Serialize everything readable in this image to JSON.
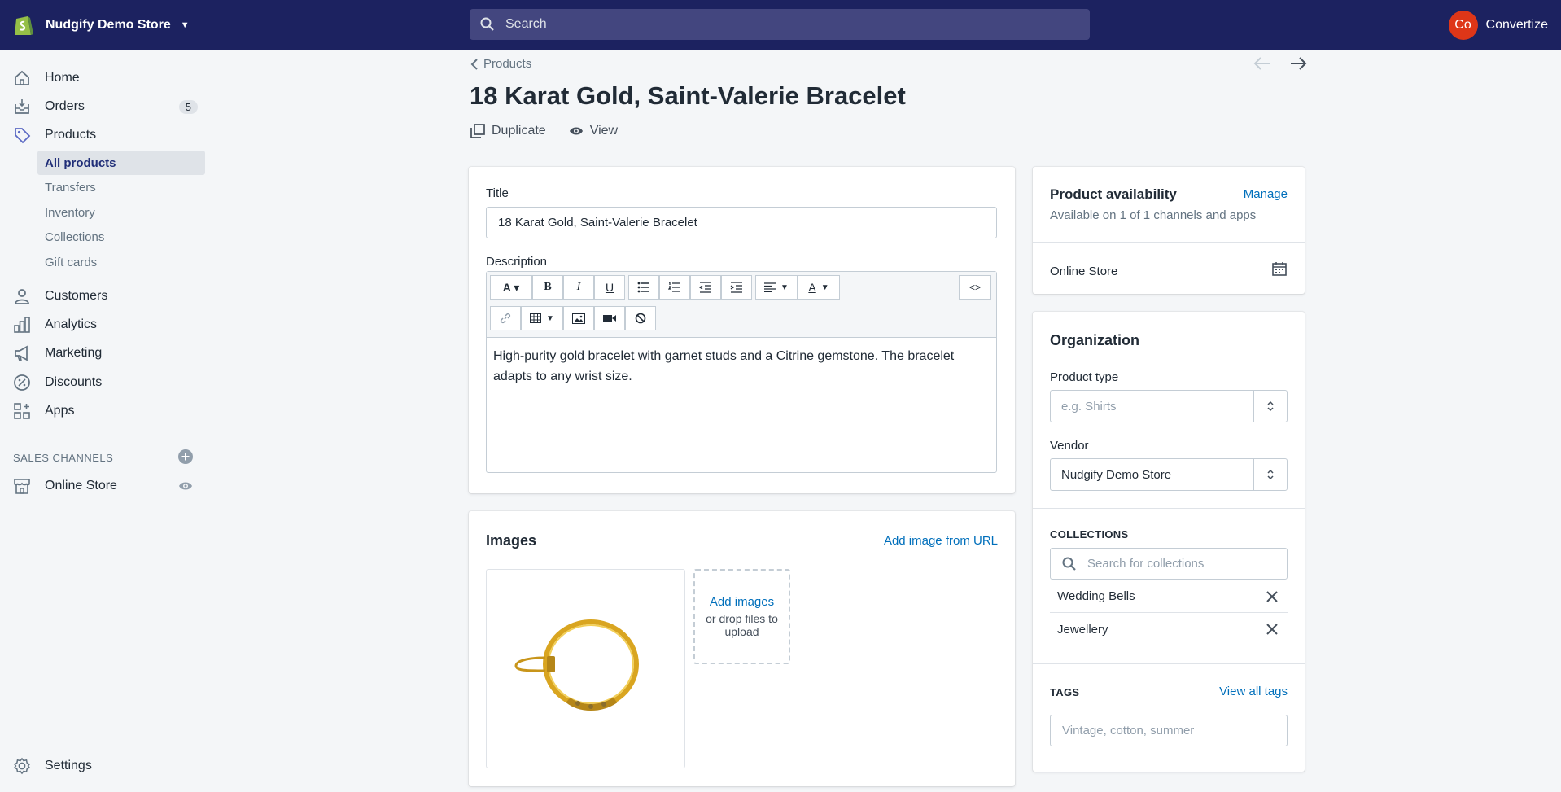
{
  "topbar": {
    "store_name": "Nudgify Demo Store",
    "search_placeholder": "Search",
    "user_initials": "Co",
    "user_name": "Convertize",
    "colors": {
      "bar": "#1c2260",
      "avatar": "#de3618"
    }
  },
  "sidebar": {
    "items": [
      {
        "label": "Home",
        "icon": "home-icon"
      },
      {
        "label": "Orders",
        "icon": "orders-icon",
        "badge": "5"
      },
      {
        "label": "Products",
        "icon": "tag-icon"
      },
      {
        "label": "Customers",
        "icon": "person-icon"
      },
      {
        "label": "Analytics",
        "icon": "bar-chart-icon"
      },
      {
        "label": "Marketing",
        "icon": "megaphone-icon"
      },
      {
        "label": "Discounts",
        "icon": "discount-icon"
      },
      {
        "label": "Apps",
        "icon": "apps-icon"
      }
    ],
    "product_subitems": [
      "All products",
      "Transfers",
      "Inventory",
      "Collections",
      "Gift cards"
    ],
    "sales_channels_header": "SALES CHANNELS",
    "online_store": "Online Store",
    "settings": "Settings"
  },
  "page": {
    "breadcrumb": "Products",
    "title": "18 Karat Gold, Saint-Valerie Bracelet",
    "duplicate": "Duplicate",
    "view": "View"
  },
  "details": {
    "title_label": "Title",
    "title_value": "18 Karat Gold, Saint-Valerie Bracelet",
    "description_label": "Description",
    "html_button": "<>",
    "description_text": "High-purity gold bracelet with garnet studs and a Citrine gemstone. The bracelet adapts to any wrist size."
  },
  "images": {
    "heading": "Images",
    "add_from_url": "Add image from URL",
    "add_images": "Add images",
    "drop_hint": "or drop files to upload"
  },
  "availability": {
    "heading": "Product availability",
    "manage": "Manage",
    "subtext": "Available on 1 of 1 channels and apps",
    "channel": "Online Store"
  },
  "organization": {
    "heading": "Organization",
    "product_type_label": "Product type",
    "product_type_placeholder": "e.g. Shirts",
    "vendor_label": "Vendor",
    "vendor_value": "Nudgify Demo Store",
    "collections_caption": "COLLECTIONS",
    "collections_placeholder": "Search for collections",
    "collections": [
      "Wedding Bells",
      "Jewellery"
    ],
    "tags_caption": "TAGS",
    "view_all_tags": "View all tags",
    "tags_placeholder": "Vintage, cotton, summer"
  }
}
